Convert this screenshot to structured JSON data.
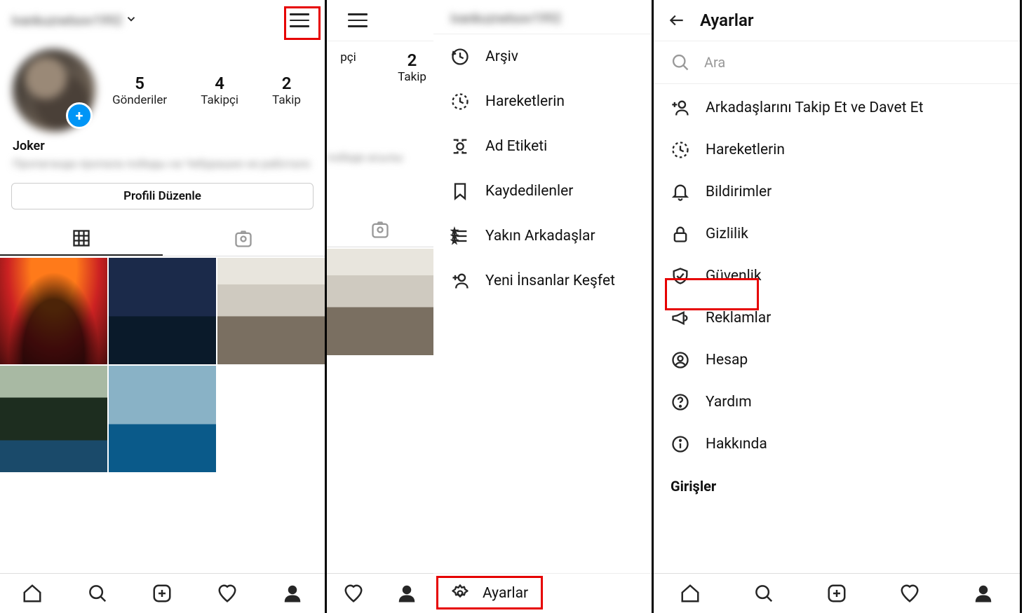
{
  "panel1": {
    "username_blur": "ivankuznetsov1992",
    "stats": [
      {
        "num": "5",
        "label": "Gönderiler"
      },
      {
        "num": "4",
        "label": "Takipçi"
      },
      {
        "num": "2",
        "label": "Takip"
      }
    ],
    "display_name": "Joker",
    "bio_blur": "Пропаганда пропала победы на Чебурашке не работало",
    "edit_button": "Profili Düzenle"
  },
  "panel2": {
    "username_blur": "ivankuznetsov1992",
    "partial_stats": [
      {
        "num_suffix": "pçi"
      },
      {
        "num": "2",
        "label": "Takip"
      }
    ],
    "bio_blur": "победе асылы",
    "drawer": [
      {
        "icon": "archive",
        "label": "Arşiv"
      },
      {
        "icon": "activity",
        "label": "Hareketlerin"
      },
      {
        "icon": "nametag",
        "label": "Ad Etiketi"
      },
      {
        "icon": "bookmark",
        "label": "Kaydedilenler"
      },
      {
        "icon": "close-friends",
        "label": "Yakın Arkadaşlar"
      },
      {
        "icon": "discover-people",
        "label": "Yeni İnsanlar Keşfet"
      }
    ],
    "settings_label": "Ayarlar"
  },
  "panel3": {
    "title": "Ayarlar",
    "search_placeholder": "Ara",
    "items": [
      {
        "icon": "add-friend",
        "label": "Arkadaşlarını Takip Et ve Davet Et"
      },
      {
        "icon": "activity",
        "label": "Hareketlerin"
      },
      {
        "icon": "bell",
        "label": "Bildirimler"
      },
      {
        "icon": "lock",
        "label": "Gizlilik"
      },
      {
        "icon": "shield",
        "label": "Güvenlik",
        "highlight": true
      },
      {
        "icon": "megaphone",
        "label": "Reklamlar"
      },
      {
        "icon": "account",
        "label": "Hesap"
      },
      {
        "icon": "help",
        "label": "Yardım"
      },
      {
        "icon": "info",
        "label": "Hakkında"
      }
    ],
    "section_label": "Girişler"
  }
}
